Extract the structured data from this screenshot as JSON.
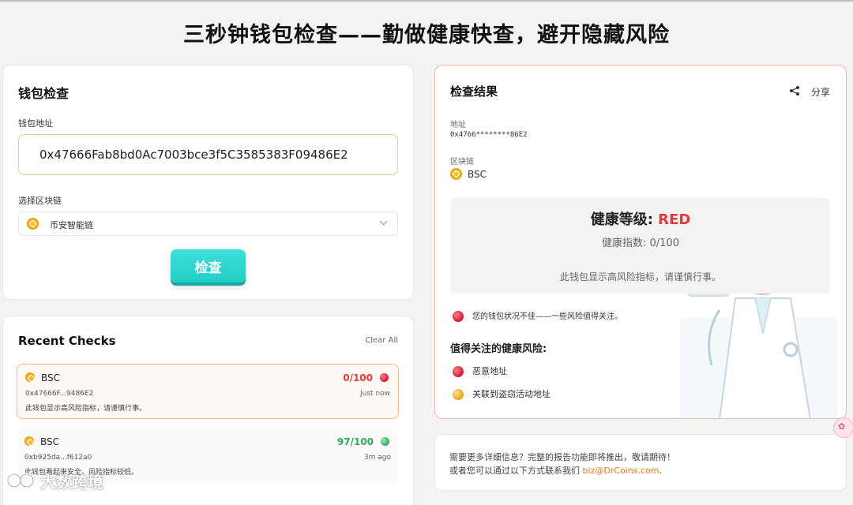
{
  "page": {
    "title": "三秒钟钱包检查——勤做健康快查，避开隐藏风险"
  },
  "wallet_check": {
    "heading": "钱包检查",
    "address_label": "钱包地址",
    "address_value": "0x47666Fab8bd0Ac7003bce3f5C3585383F09486E2",
    "chain_label": "选择区块链",
    "chain_selected": "币安智能链",
    "check_button": "检查"
  },
  "recent_checks": {
    "heading": "Recent Checks",
    "clear_all": "Clear All",
    "items": [
      {
        "chain": "BSC",
        "address": "0x47666F...9486E2",
        "note": "此钱包显示高风险指标，请谨慎行事。",
        "score": "0/100",
        "time": "Just now",
        "status": "red"
      },
      {
        "chain": "BSC",
        "address": "0xb925da...f612a0",
        "note": "此钱包看起来安全，风险指标较低。",
        "score": "97/100",
        "time": "3m ago",
        "status": "green"
      }
    ]
  },
  "result": {
    "heading": "检查结果",
    "share": "分享",
    "address_label": "地址",
    "address_value": "0x4766********86E2",
    "chain_label": "区块链",
    "chain_value": "BSC",
    "health_label": "健康等级: ",
    "health_level": "RED",
    "health_index": "健康指数: 0/100",
    "health_message": "此钱包显示高风险指标，请谨慎行事。",
    "summary": "您的钱包状况不佳——一些风险值得关注。",
    "risks_heading": "值得关注的健康风险:",
    "risks": [
      {
        "label": "恶意地址",
        "severity": "red"
      },
      {
        "label": "关联到盗窃活动地址",
        "severity": "gold"
      }
    ]
  },
  "info": {
    "line1": "需要更多详细信息？完整的报告功能即将推出，敬请期待！",
    "line2_prefix": "或者您可以通过以下方式联系我们 ",
    "email": "biz@DrCoins.com",
    "line2_suffix": "."
  },
  "watermark": {
    "text": "大数跨境"
  },
  "colors": {
    "accent": "#22cdc6",
    "danger": "#e53935",
    "safe": "#2eaa5a",
    "input_border": "#f0c29a",
    "result_border": "#f2b6aa"
  }
}
